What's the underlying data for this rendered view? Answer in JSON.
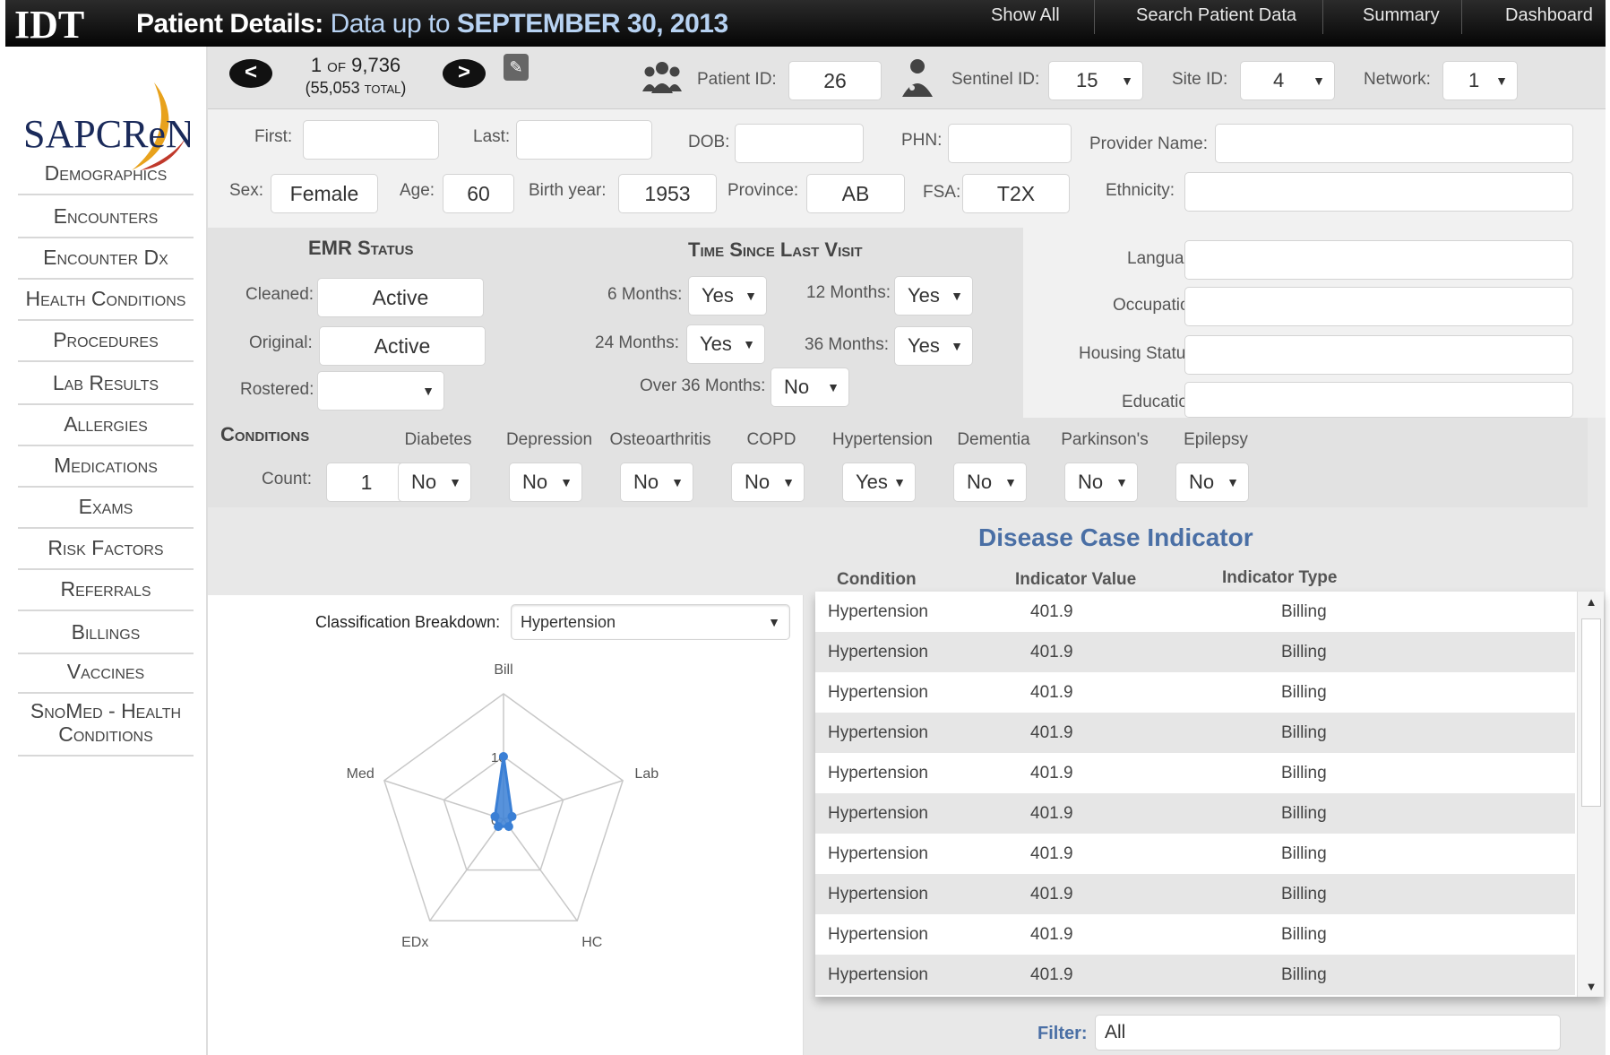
{
  "header": {
    "logo_text": "IDT",
    "title_bold": "Patient Details:",
    "title_mid": "Data up to",
    "title_date": "SEPTEMBER 30, 2013",
    "nav": [
      "Show All",
      "Search Patient Data",
      "Summary",
      "Dashboard"
    ]
  },
  "sidebar": {
    "logo_text": "SAPCReN",
    "items": [
      "Demographics",
      "Encounters",
      "Encounter Dx",
      "Health Conditions",
      "Procedures",
      "Lab Results",
      "Allergies",
      "Medications",
      "Exams",
      "Risk Factors",
      "Referrals",
      "Billings",
      "Vaccines",
      "SnoMed - Health Conditions"
    ]
  },
  "pager": {
    "position": "1 of 9,736",
    "total": "(55,053 total)",
    "prev": "<",
    "next": ">"
  },
  "ids": {
    "patient_label": "Patient ID:",
    "patient_value": "26",
    "sentinel_label": "Sentinel ID:",
    "sentinel_value": "15",
    "site_label": "Site ID:",
    "site_value": "4",
    "network_label": "Network:",
    "network_value": "1"
  },
  "demographics": {
    "first_label": "First:",
    "first_value": "",
    "last_label": "Last:",
    "last_value": "",
    "dob_label": "DOB:",
    "dob_value": "",
    "phn_label": "PHN:",
    "phn_value": "",
    "provider_label": "Provider Name:",
    "provider_value": "",
    "sex_label": "Sex:",
    "sex_value": "Female",
    "age_label": "Age:",
    "age_value": "60",
    "birth_label": "Birth year:",
    "birth_value": "1953",
    "province_label": "Province:",
    "province_value": "AB",
    "fsa_label": "FSA:",
    "fsa_value": "T2X",
    "ethnicity_label": "Ethnicity:",
    "ethnicity_value": "",
    "language_label": "Language:",
    "language_value": "",
    "occupation_label": "Occupation:",
    "occupation_value": "",
    "housing_label": "Housing Status:",
    "housing_value": "",
    "education_label": "Education:",
    "education_value": ""
  },
  "emr": {
    "title": "EMR Status",
    "cleaned_label": "Cleaned:",
    "cleaned_value": "Active",
    "original_label": "Original:",
    "original_value": "Active",
    "rostered_label": "Rostered:",
    "rostered_value": ""
  },
  "visit": {
    "title": "Time Since Last Visit",
    "m6_label": "6 Months:",
    "m6_value": "Yes",
    "m12_label": "12 Months:",
    "m12_value": "Yes",
    "m24_label": "24 Months:",
    "m24_value": "Yes",
    "m36_label": "36 Months:",
    "m36_value": "Yes",
    "over36_label": "Over 36 Months:",
    "over36_value": "No"
  },
  "conditions": {
    "title": "Conditions",
    "count_label": "Count:",
    "count_value": "1",
    "items": [
      {
        "name": "Diabetes",
        "value": "No"
      },
      {
        "name": "Depression",
        "value": "No"
      },
      {
        "name": "Osteoarthritis",
        "value": "No"
      },
      {
        "name": "COPD",
        "value": "No"
      },
      {
        "name": "Hypertension",
        "value": "Yes"
      },
      {
        "name": "Dementia",
        "value": "No"
      },
      {
        "name": "Parkinson's",
        "value": "No"
      },
      {
        "name": "Epilepsy",
        "value": "No"
      }
    ]
  },
  "classification": {
    "label": "Classification Breakdown:",
    "value": "Hypertension"
  },
  "chart_data": {
    "type": "radar",
    "axes": [
      "Bill",
      "Lab",
      "HC",
      "EDx",
      "Med"
    ],
    "values": [
      10,
      0,
      0,
      0,
      0
    ],
    "rlim": [
      0,
      20
    ],
    "tick_labels": [
      "0",
      "10"
    ],
    "fill_color": "#3a7fd5"
  },
  "disease_table": {
    "title": "Disease Case Indicator",
    "columns": [
      "Condition",
      "Indicator Value",
      "Indicator Type"
    ],
    "rows": [
      [
        "Hypertension",
        "401.9",
        "Billing"
      ],
      [
        "Hypertension",
        "401.9",
        "Billing"
      ],
      [
        "Hypertension",
        "401.9",
        "Billing"
      ],
      [
        "Hypertension",
        "401.9",
        "Billing"
      ],
      [
        "Hypertension",
        "401.9",
        "Billing"
      ],
      [
        "Hypertension",
        "401.9",
        "Billing"
      ],
      [
        "Hypertension",
        "401.9",
        "Billing"
      ],
      [
        "Hypertension",
        "401.9",
        "Billing"
      ],
      [
        "Hypertension",
        "401.9",
        "Billing"
      ],
      [
        "Hypertension",
        "401.9",
        "Billing"
      ]
    ]
  },
  "filter": {
    "label": "Filter:",
    "value": "All"
  },
  "colors": {
    "accent_blue": "#4a6fa5",
    "topbar": "#111111",
    "title_blue": "#b7d2f2"
  }
}
